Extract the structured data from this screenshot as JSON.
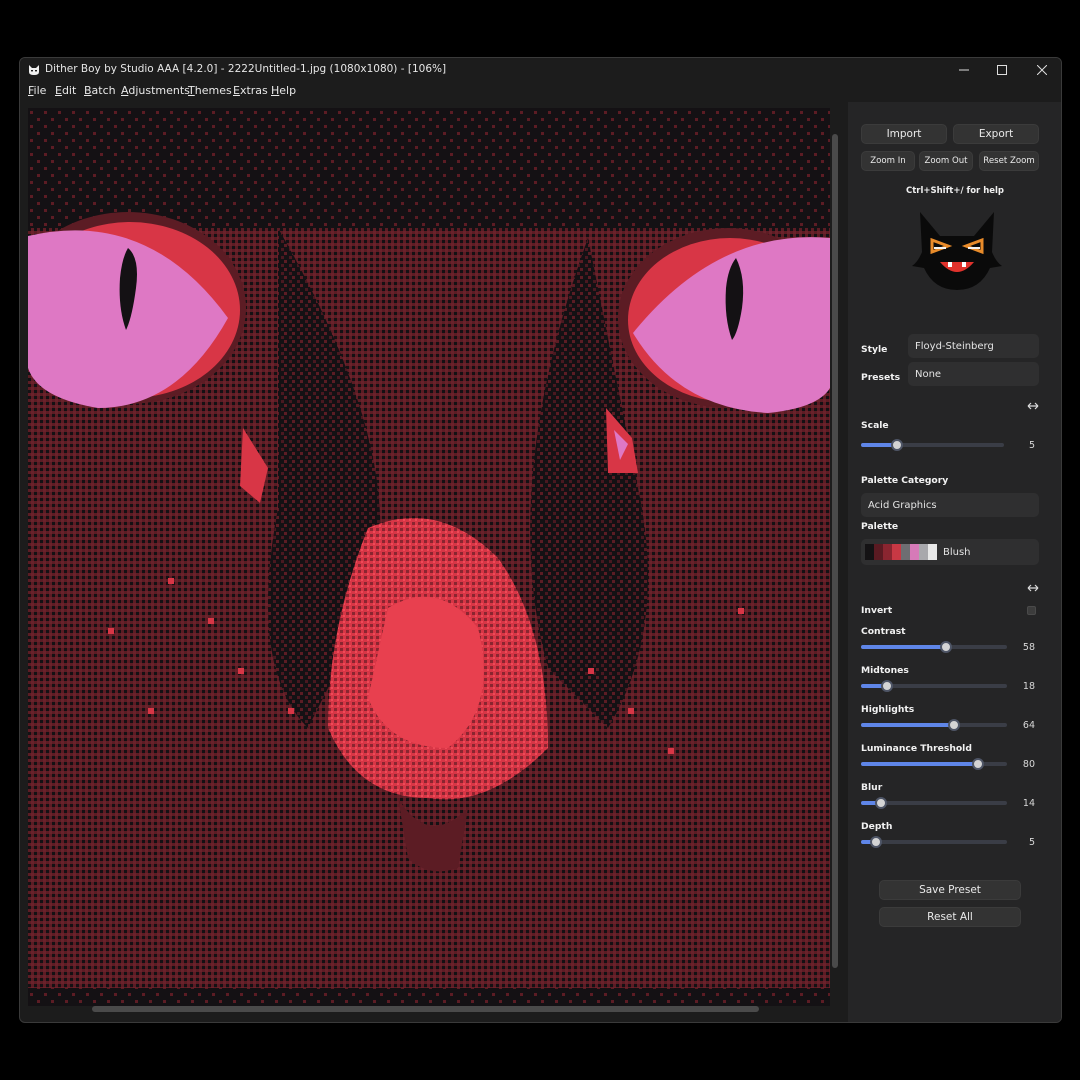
{
  "window": {
    "title": "Dither Boy by Studio AAA [4.2.0] - 2222Untitled-1.jpg (1080x1080) - [106%]",
    "minimize_icon": "minimize-icon",
    "maximize_icon": "maximize-icon",
    "close_icon": "close-icon"
  },
  "menu": [
    "File",
    "Edit",
    "Batch",
    "Adjustments",
    "Themes",
    "Extras",
    "Help"
  ],
  "toolbar": {
    "import": "Import",
    "export": "Export",
    "zoom_in": "Zoom In",
    "zoom_out": "Zoom Out",
    "reset_zoom": "Reset Zoom"
  },
  "help_hint": "Ctrl+Shift+/ for help",
  "style": {
    "label": "Style",
    "value": "Floyd-Steinberg"
  },
  "presets": {
    "label": "Presets",
    "value": "None"
  },
  "scale": {
    "label": "Scale",
    "value": "5",
    "fraction": 0.25
  },
  "palette_category": {
    "label": "Palette Category",
    "value": "Acid Graphics"
  },
  "palette": {
    "label": "Palette",
    "value": "Blush",
    "swatches": [
      "#141214",
      "#5a1a22",
      "#8a2530",
      "#c83844",
      "#6e6e72",
      "#d67ab8",
      "#a8a8ac",
      "#e8e8e8"
    ]
  },
  "invert": {
    "label": "Invert",
    "checked": false
  },
  "adjustments": {
    "contrast": {
      "label": "Contrast",
      "value": "58",
      "fraction": 0.58
    },
    "midtones": {
      "label": "Midtones",
      "value": "18",
      "fraction": 0.18
    },
    "highlights": {
      "label": "Highlights",
      "value": "64",
      "fraction": 0.64
    },
    "luminance": {
      "label": "Luminance Threshold",
      "value": "80",
      "fraction": 0.8
    },
    "blur": {
      "label": "Blur",
      "value": "14",
      "fraction": 0.14
    },
    "depth": {
      "label": "Depth",
      "value": "5",
      "fraction": 0.1
    }
  },
  "actions": {
    "save_preset": "Save Preset",
    "reset_all": "Reset All"
  },
  "colors": {
    "dither_dark": "#141114",
    "dither_maroon": "#5c1c24",
    "dither_red": "#d83646",
    "dither_pink": "#de78c4",
    "accent": "#5f86e8"
  }
}
